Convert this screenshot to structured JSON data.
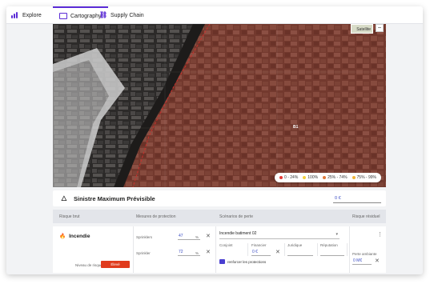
{
  "nav": {
    "tabs": [
      {
        "label": "Explore",
        "icon": "bar-chart-icon"
      },
      {
        "label": "Cartography",
        "icon": "map-icon",
        "active": true
      },
      {
        "label": "Supply Chain",
        "icon": "chain-icon"
      }
    ]
  },
  "map": {
    "minimap_label": "Satellite",
    "zoom_label": "−",
    "building_label": "B1",
    "legend": [
      {
        "label": "0 - 24%",
        "color": "#e53935"
      },
      {
        "label": "100%",
        "color": "#f4d03f"
      },
      {
        "label": "25% - 74%",
        "color": "#e07a3c"
      },
      {
        "label": "75% - 99%",
        "color": "#f0b53a"
      }
    ]
  },
  "smp": {
    "title": "Sinistre Maximum Prévisible",
    "value": "0 €"
  },
  "table": {
    "headers": {
      "risk": "Risque brut",
      "protection": "Mesures de protection",
      "scenario": "Scénarios de perte",
      "residual": "Risque résiduel"
    },
    "row": {
      "risk_name": "Incendie",
      "risk_level_label": "Niveau de risque",
      "risk_level_value": "Élevé",
      "protection": {
        "sprinklers_label": "Sprinklers",
        "sprinklers_value": "47",
        "sprinklers_unit": "%",
        "sprinkler_label": "Sprinkler",
        "sprinkler_value": "72",
        "sprinkler_unit": "%"
      },
      "scenario": {
        "selected": "Incendie batiment 02",
        "col1_label": "Conjoint",
        "col2_label": "Financier",
        "col2_value": "0 €",
        "col3_label": "Juridique",
        "col4_label": "Réputation",
        "link_label": "renforcer les protections"
      },
      "residual": {
        "label": "Perte ambiante",
        "value": "0 M€"
      }
    }
  }
}
